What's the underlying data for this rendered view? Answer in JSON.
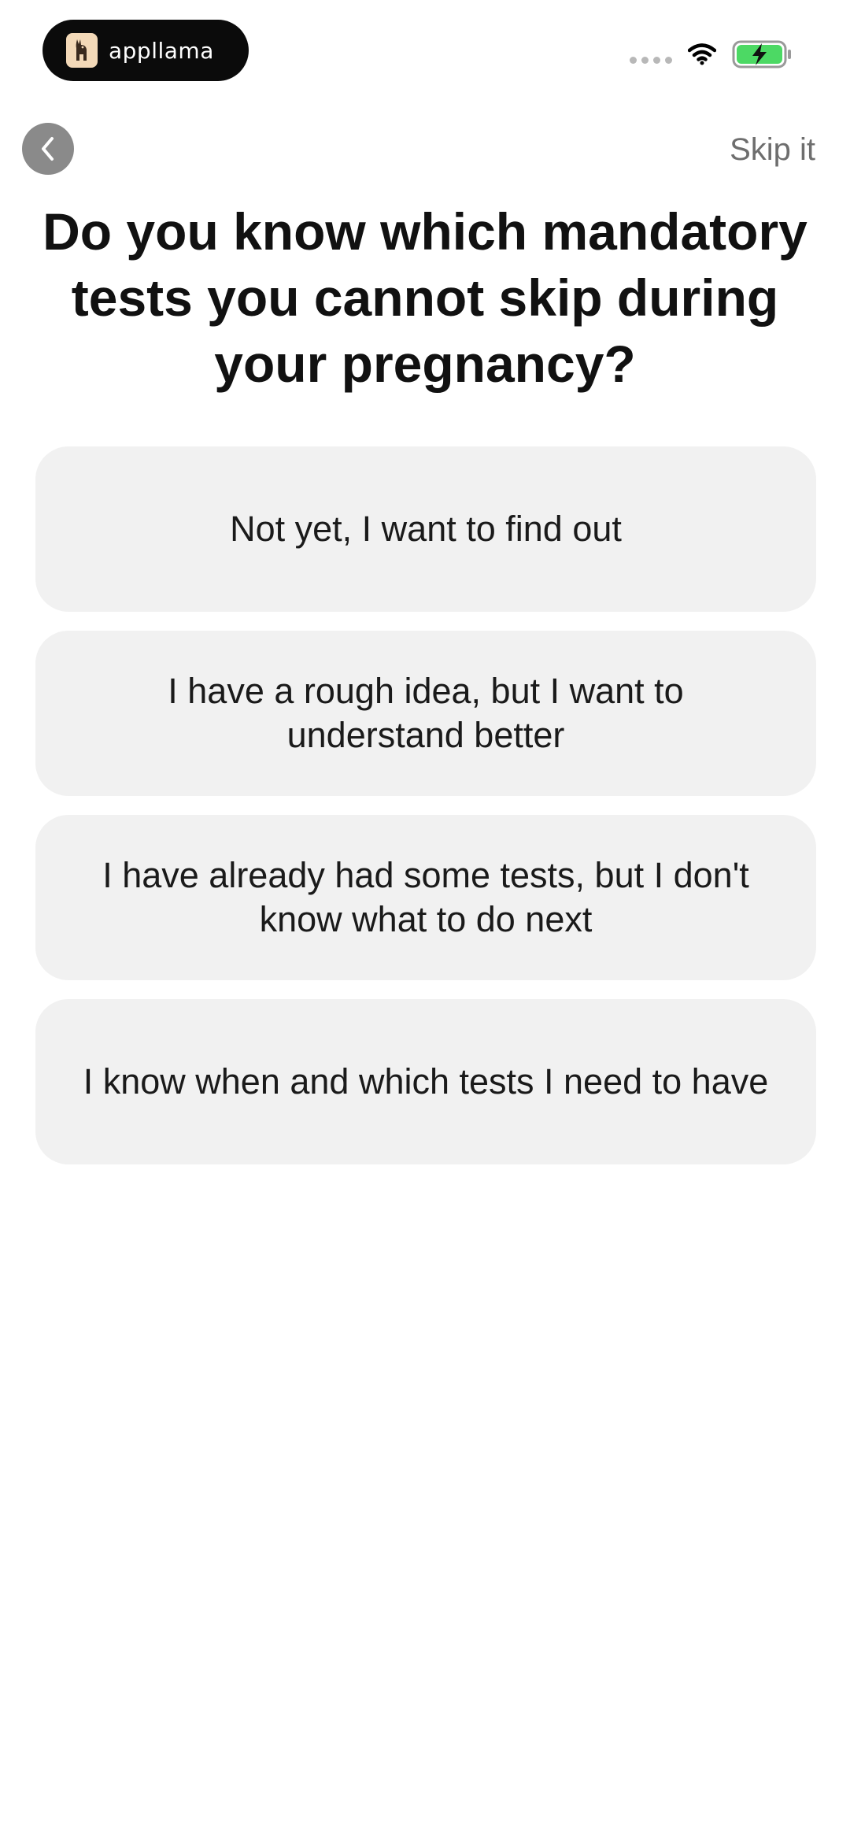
{
  "status_bar": {
    "brand_name": "appllama",
    "brand_logo_icon": "llama-logo-icon",
    "signal_icon": "signal-dots-icon",
    "wifi_icon": "wifi-icon",
    "battery_icon": "battery-charging-icon",
    "battery_color": "#4cd964"
  },
  "nav": {
    "back_icon": "chevron-left-icon",
    "skip_label": "Skip it"
  },
  "question": {
    "title": "Do you know which mandatory tests you cannot skip during your pregnancy?"
  },
  "options": [
    {
      "label": "Not yet, I want to find out"
    },
    {
      "label": "I have a rough idea, but I want to understand better"
    },
    {
      "label": "I have already had some tests, but I don't know what to do next"
    },
    {
      "label": "I know when and which tests I need to have"
    }
  ],
  "colors": {
    "option_background": "#f1f1f1",
    "back_button_background": "#8a8a8a",
    "skip_text": "#6e6e6e"
  }
}
